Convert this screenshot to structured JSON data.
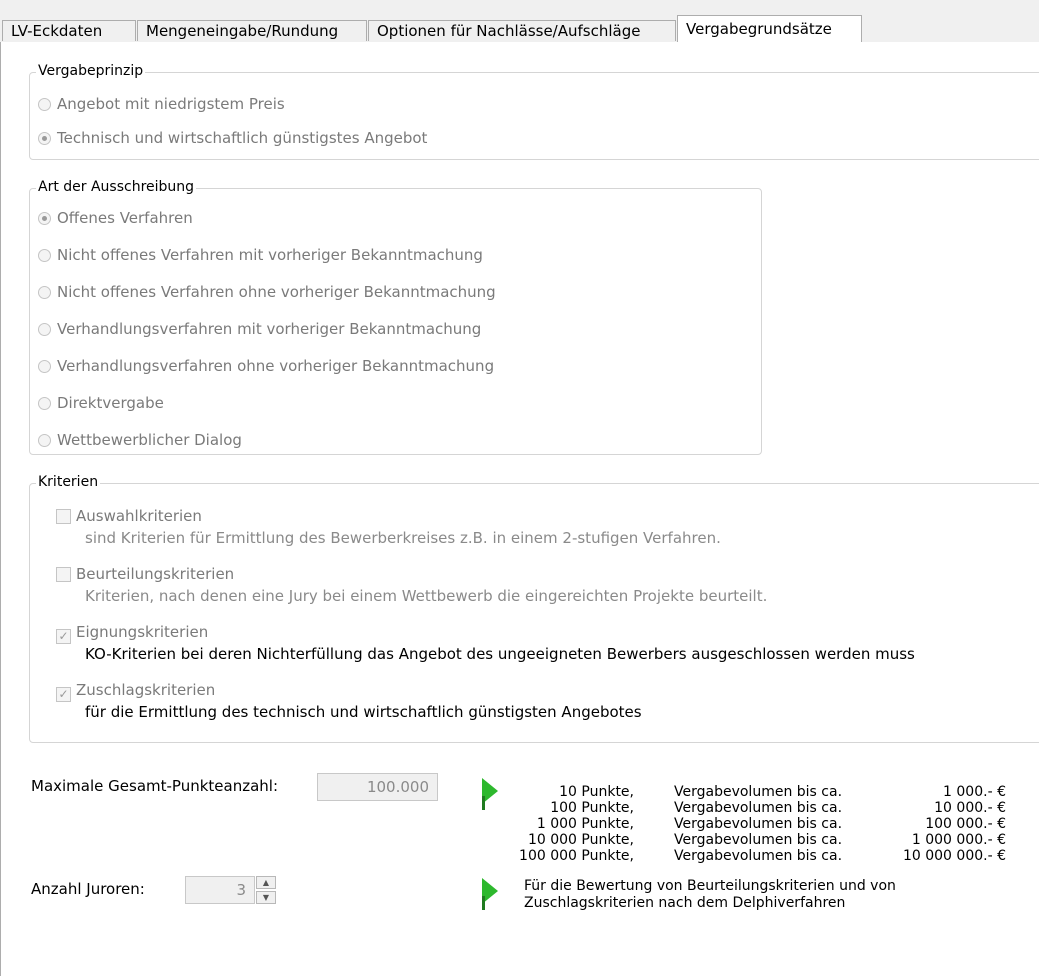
{
  "tabs": [
    "LV-Eckdaten",
    "Mengeneingabe/Rundung",
    "Optionen für Nachlässe/Aufschläge",
    "Vergabegrundsätze"
  ],
  "vergabeprinzip": {
    "title": "Vergabeprinzip",
    "options": [
      "Angebot mit niedrigstem Preis",
      "Technisch und wirtschaftlich günstigstes Angebot"
    ],
    "selected": 1
  },
  "ausschreibung": {
    "title": "Art der Ausschreibung",
    "options": [
      "Offenes Verfahren",
      "Nicht offenes Verfahren mit vorheriger Bekanntmachung",
      "Nicht offenes Verfahren ohne vorheriger Bekanntmachung",
      "Verhandlungsverfahren mit vorheriger Bekanntmachung",
      "Verhandlungsverfahren ohne vorheriger Bekanntmachung",
      "Direktvergabe",
      "Wettbewerblicher Dialog"
    ],
    "selected": 0
  },
  "kriterien": {
    "title": "Kriterien",
    "items": [
      {
        "label": "Auswahlkriterien",
        "desc": "sind Kriterien für Ermittlung des Bewerberkreises z.B. in einem 2-stufigen Verfahren.",
        "checked": false
      },
      {
        "label": "Beurteilungskriterien",
        "desc": "Kriterien, nach denen eine Jury bei einem Wettbewerb die eingereichten Projekte beurteilt.",
        "checked": false
      },
      {
        "label": "Eignungskriterien",
        "desc": "KO-Kriterien bei deren Nichterfüllung das Angebot des ungeeigneten Bewerbers ausgeschlossen werden muss",
        "checked": true
      },
      {
        "label": "Zuschlagskriterien",
        "desc": "für die Ermittlung des technisch und wirtschaftlich günstigsten Angebotes",
        "checked": true
      }
    ]
  },
  "punkte": {
    "label": "Maximale Gesamt-Punkteanzahl:",
    "value": "100.000",
    "table": [
      {
        "points": "10 Punkte,",
        "text": "Vergabevolumen bis ca.",
        "amount": "1 000.- €"
      },
      {
        "points": "100 Punkte,",
        "text": "Vergabevolumen bis ca.",
        "amount": "10 000.- €"
      },
      {
        "points": "1 000 Punkte,",
        "text": "Vergabevolumen bis ca.",
        "amount": "100 000.- €"
      },
      {
        "points": "10 000 Punkte,",
        "text": "Vergabevolumen bis ca.",
        "amount": "1 000 000.- €"
      },
      {
        "points": "100 000 Punkte,",
        "text": "Vergabevolumen bis ca.",
        "amount": "10 000 000.- €"
      }
    ]
  },
  "juroren": {
    "label": "Anzahl Juroren:",
    "value": "3",
    "note_line1": "Für die Bewertung von Beurteilungskriterien und von",
    "note_line2": "Zuschlagskriterien nach dem Delphiverfahren"
  },
  "icons": {
    "arrow": "green-play-arrow-icon",
    "spin": "spin-up-down-icon"
  },
  "colors": {
    "arrow": "#2db82d",
    "disabled_text": "#7a7a7a"
  }
}
